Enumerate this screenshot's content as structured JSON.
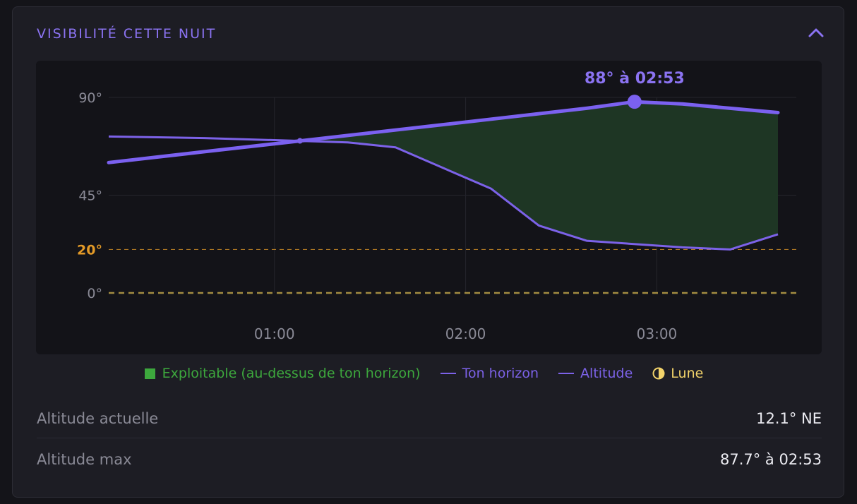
{
  "panel": {
    "title": "VISIBILITÉ CETTE NUIT",
    "collapse_icon": "chevron-up-icon"
  },
  "chart_data": {
    "type": "line",
    "ylim": [
      0,
      90
    ],
    "y_ticks": [
      {
        "value": 90,
        "label": "90°"
      },
      {
        "value": 45,
        "label": "45°"
      },
      {
        "value": 20,
        "label": "20°"
      },
      {
        "value": 0,
        "label": "0°"
      }
    ],
    "x_ticks": [
      "01:00",
      "02:00",
      "03:00"
    ],
    "x_range": [
      "00:08",
      "03:38"
    ],
    "grid": true,
    "peak_annotation": "88° à 02:53",
    "peak": {
      "time": "02:53",
      "value": 88
    },
    "thresholds": [
      {
        "value": 20,
        "style": "dashed",
        "color": "#e39a27"
      },
      {
        "value": 0,
        "style": "dashed",
        "color": "#b29a46"
      }
    ],
    "series": [
      {
        "name": "Ton horizon",
        "color": "#7c62e8",
        "x": [
          "00:08",
          "00:38",
          "01:08",
          "01:23",
          "01:38",
          "02:08",
          "02:23",
          "02:38",
          "03:08",
          "03:23",
          "03:38"
        ],
        "values": [
          72,
          71.3,
          70,
          69.3,
          67,
          48,
          31,
          24,
          21,
          20,
          27
        ]
      },
      {
        "name": "Altitude",
        "color": "#7b61f0",
        "x": [
          "00:08",
          "00:38",
          "01:08",
          "01:38",
          "02:08",
          "02:38",
          "02:53",
          "03:08",
          "03:23",
          "03:38"
        ],
        "values": [
          60,
          65,
          70,
          75,
          80,
          85,
          88,
          87,
          85,
          83
        ]
      }
    ],
    "fill": {
      "name": "Exploitable (au-dessus de ton horizon)",
      "color": "#1e3624"
    },
    "legend": [
      {
        "label": "Exploitable (au-dessus de ton horizon)",
        "color": "#3da83d"
      },
      {
        "label": "Ton horizon",
        "color": "#7c62e8"
      },
      {
        "label": "Altitude",
        "color": "#7c62e8"
      },
      {
        "label": "Lune",
        "color": "#f2d36a"
      }
    ]
  },
  "stats": [
    {
      "label": "Altitude actuelle",
      "value": "12.1° NE"
    },
    {
      "label": "Altitude max",
      "value": "87.7° à 02:53"
    }
  ]
}
